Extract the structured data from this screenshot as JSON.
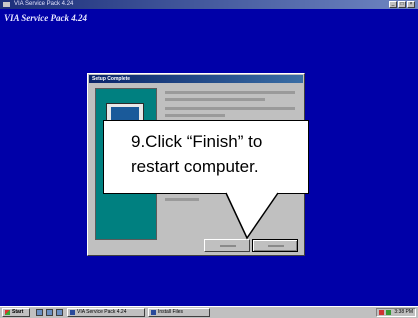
{
  "window": {
    "title": "VIA Service Pack 4.24",
    "controls": [
      "_",
      "□",
      "×"
    ]
  },
  "banner": {
    "text": "VIA Service Pack 4.24"
  },
  "dialog": {
    "title": "Setup Complete",
    "buttons": {
      "back": "< Back",
      "finish": "Finish"
    }
  },
  "callout": {
    "line1": "9.Click “Finish” to",
    "line2": "restart computer."
  },
  "taskbar": {
    "start_label": "Start",
    "items": [
      "VIA Service Pack 4.24",
      "Install Files"
    ],
    "clock": "3:38 PM"
  },
  "colors": {
    "desktop": "#0000a8",
    "teal_art": "#008080",
    "dialog_face": "#c0c0c0",
    "callout_bg": "#ffffff"
  }
}
